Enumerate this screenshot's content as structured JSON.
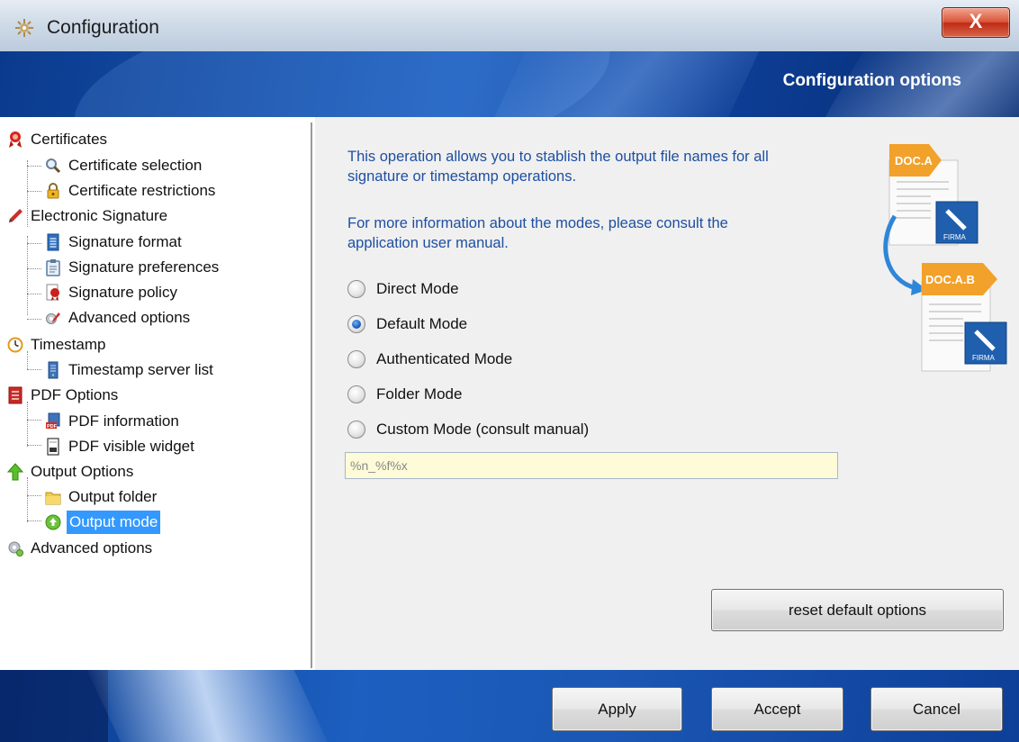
{
  "window": {
    "title": "Configuration",
    "close_label": "X"
  },
  "banner": {
    "heading": "Configuration options"
  },
  "tree": {
    "certificates": "Certificates",
    "certificate_selection": "Certificate selection",
    "certificate_restrictions": "Certificate restrictions",
    "electronic_signature": "Electronic Signature",
    "signature_format": "Signature format",
    "signature_preferences": "Signature preferences",
    "signature_policy": "Signature policy",
    "advanced_options_sig": "Advanced options",
    "timestamp": "Timestamp",
    "timestamp_server_list": "Timestamp server list",
    "pdf_options": "PDF Options",
    "pdf_information": "PDF information",
    "pdf_visible_widget": "PDF visible widget",
    "output_options": "Output Options",
    "output_folder": "Output folder",
    "output_mode": "Output mode",
    "advanced_options": "Advanced options"
  },
  "content": {
    "desc1_line1": "This operation allows you to stablish the output file names for all",
    "desc1_line2": "signature or timestamp operations.",
    "desc2_line1": "For more information about the modes, please consult the",
    "desc2_line2": "application user manual.",
    "modes": {
      "direct": "Direct Mode",
      "default": "Default Mode",
      "authenticated": "Authenticated Mode",
      "folder": "Folder Mode",
      "custom": "Custom Mode   (consult manual)"
    },
    "selected_mode": "Default Mode",
    "pattern_value": "%n_%f%x",
    "reset_label": "reset default options",
    "illustration": {
      "doc_a": "DOC.A",
      "doc_ab": "DOC.A.B",
      "badge": "FIRMA"
    }
  },
  "footer": {
    "apply": "Apply",
    "accept": "Accept",
    "cancel": "Cancel"
  },
  "colors": {
    "banner_blue": "#1c5fc0",
    "selection": "#3399ff",
    "desc_text": "#1e4fa1",
    "input_bg": "#fdfbd8"
  }
}
